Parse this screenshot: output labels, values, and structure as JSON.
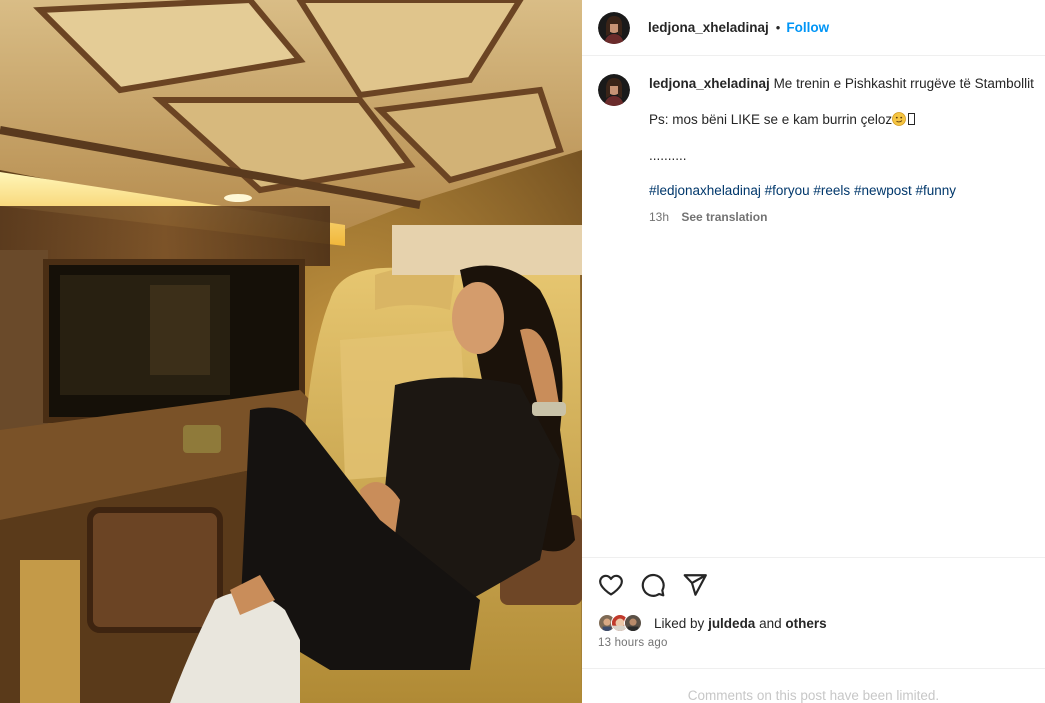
{
  "post": {
    "username": "ledjona_xheladinaj",
    "separator": "•",
    "follow_label": "Follow",
    "caption": {
      "username": "ledjona_xheladinaj",
      "line1": "Me trenin e Pishkashit rrugëve të Stambollit",
      "line2": "Ps: mos bëni LIKE se e kam burrin çeloz",
      "line3": "..........",
      "hashtags": [
        "#ledjonaxheladinaj",
        "#foryou",
        "#reels",
        "#newpost",
        "#funny"
      ],
      "time_ago": "13h",
      "see_translation": "See translation"
    },
    "likes": {
      "prefix": "Liked by",
      "liker": "juldeda",
      "conjunction": "and",
      "others": "others"
    },
    "timestamp": "13 hours ago",
    "comments_limited": "Comments on this post have been limited."
  },
  "icons": {
    "like": "heart-icon",
    "comment": "comment-icon",
    "share": "share-icon"
  },
  "colors": {
    "follow": "#0095f6",
    "hashtag": "#00376b",
    "muted": "#737373",
    "limited": "#c7c7c7"
  }
}
